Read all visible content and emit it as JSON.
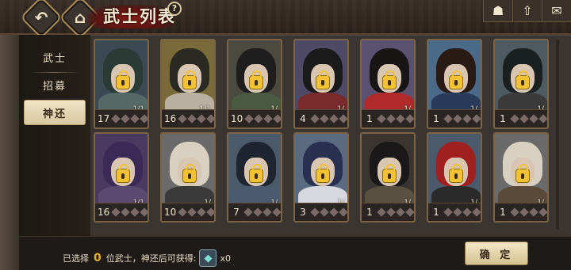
{
  "header": {
    "title": "武士列表",
    "help_label": "?",
    "back_icon": "back-arrow-icon",
    "home_icon": "castle-icon",
    "right_buttons": [
      {
        "name": "character-icon",
        "glyph": "☗"
      },
      {
        "name": "upgrade-icon",
        "glyph": "⇧"
      },
      {
        "name": "mail-icon",
        "glyph": "✉"
      }
    ]
  },
  "sidebar": {
    "items": [
      {
        "label": "武士",
        "active": false
      },
      {
        "label": "招募",
        "active": false
      },
      {
        "label": "神还",
        "active": true
      }
    ]
  },
  "cards": [
    {
      "level": "17",
      "frac": "1/1",
      "hair": "#2a3a35",
      "cloth": "#556a66",
      "bg": "#3b4a52"
    },
    {
      "level": "16",
      "frac": "1/1",
      "hair": "#2a2a22",
      "cloth": "#b8b0a0",
      "bg": "#7a6a3a"
    },
    {
      "level": "10",
      "frac": "1/",
      "hair": "#1e1e1e",
      "cloth": "#4a5a40",
      "bg": "#4a4a40"
    },
    {
      "level": "4",
      "frac": "1/",
      "hair": "#1a1a1a",
      "cloth": "#7a2a2a",
      "bg": "#4e4a66"
    },
    {
      "level": "1",
      "frac": "1/",
      "hair": "#1a1515",
      "cloth": "#b02a2a",
      "bg": "#5a5070"
    },
    {
      "level": "1",
      "frac": "1/",
      "hair": "#2a1a15",
      "cloth": "#2a3a5a",
      "bg": "#4a6a88"
    },
    {
      "level": "1",
      "frac": "1/",
      "hair": "#1a2020",
      "cloth": "#3a3a3a",
      "bg": "#4e5a60"
    },
    {
      "level": "16",
      "frac": "1/1",
      "hair": "#3a2a55",
      "cloth": "#5a4a70",
      "bg": "#4a3a60"
    },
    {
      "level": "10",
      "frac": "1/",
      "hair": "#d8d0c0",
      "cloth": "#3a3a3a",
      "bg": "#6a6a6a"
    },
    {
      "level": "7",
      "frac": "1/",
      "hair": "#1e2530",
      "cloth": "#4a5a70",
      "bg": "#4a5a6a"
    },
    {
      "level": "3",
      "frac": "1/",
      "hair": "#2a3050",
      "cloth": "#d8d8e0",
      "bg": "#5a6a80"
    },
    {
      "level": "1",
      "frac": "1/",
      "hair": "#1a1818",
      "cloth": "#5a5040",
      "bg": "#3a3530"
    },
    {
      "level": "1",
      "frac": "1/",
      "hair": "#a02020",
      "cloth": "#2a2a2a",
      "bg": "#4a5a6a"
    },
    {
      "level": "1",
      "frac": "1/",
      "hair": "#d8d0c0",
      "cloth": "#5a4a3a",
      "bg": "#6a6a6a"
    }
  ],
  "footer": {
    "prefix": "已选择",
    "count": "0",
    "suffix": "位武士，神还后可获得:",
    "reward_icon": "crystal-icon",
    "reward_qty": "x0",
    "confirm_label": "确 定"
  }
}
